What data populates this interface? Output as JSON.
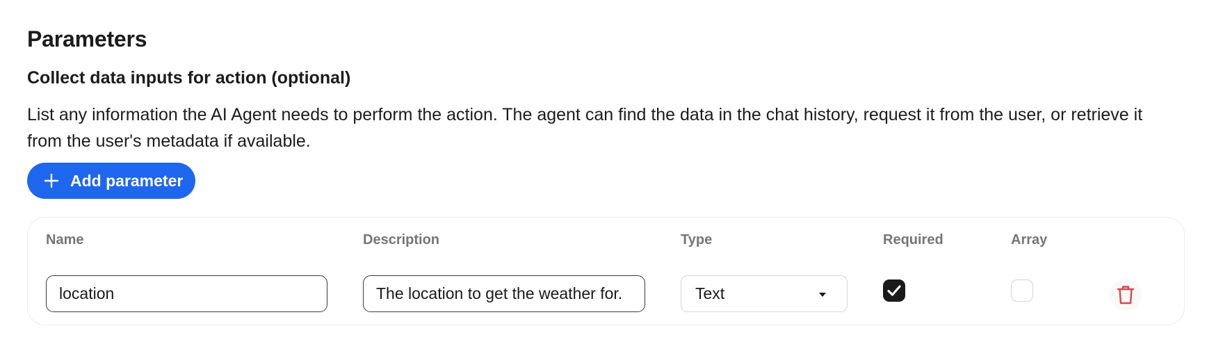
{
  "section": {
    "title": "Parameters",
    "subtitle": "Collect data inputs for action (optional)",
    "description": "List any information the AI Agent needs to perform the action. The agent can find the data in the chat history, request it from the user, or retrieve it from the user's metadata if available."
  },
  "add_button": {
    "label": "Add parameter",
    "icon": "plus-icon",
    "color": "#1e66ee"
  },
  "table": {
    "columns": [
      "Name",
      "Description",
      "Type",
      "Required",
      "Array"
    ],
    "rows": [
      {
        "name": "location",
        "description": "The location to get the weather for.",
        "type": "Text",
        "required": true,
        "array": false
      }
    ]
  },
  "colors": {
    "delete_icon": "#e0434e",
    "checkbox_checked": "#1a1a1a"
  }
}
